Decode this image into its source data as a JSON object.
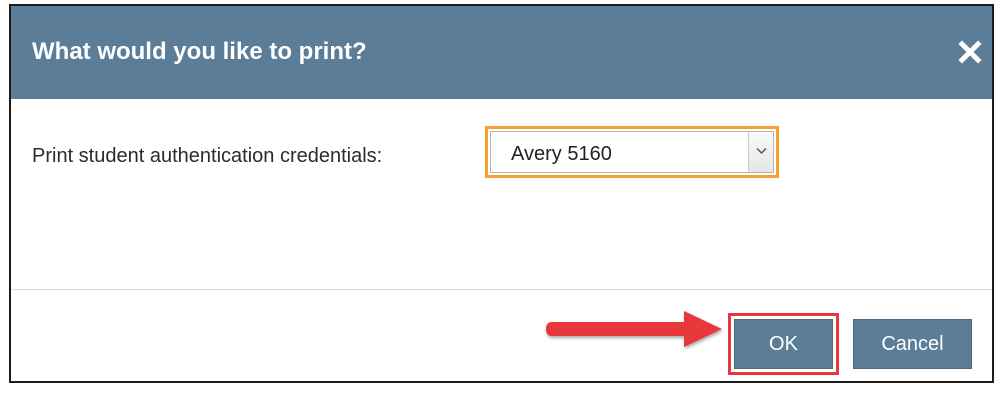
{
  "dialog": {
    "title": "What would you like to print?",
    "close_icon": "close-icon",
    "header_color": "#5b7d97"
  },
  "form": {
    "label": "Print student authentication credentials:",
    "select": {
      "value": "Avery 5160",
      "arrow_icon": "chevron-down-icon",
      "focus_color": "#f2a22d"
    }
  },
  "footer": {
    "ok_label": "OK",
    "cancel_label": "Cancel",
    "button_color": "#5b7d97"
  },
  "annotation": {
    "arrow_icon": "arrow-right-icon",
    "highlight_color": "#e8373a"
  }
}
